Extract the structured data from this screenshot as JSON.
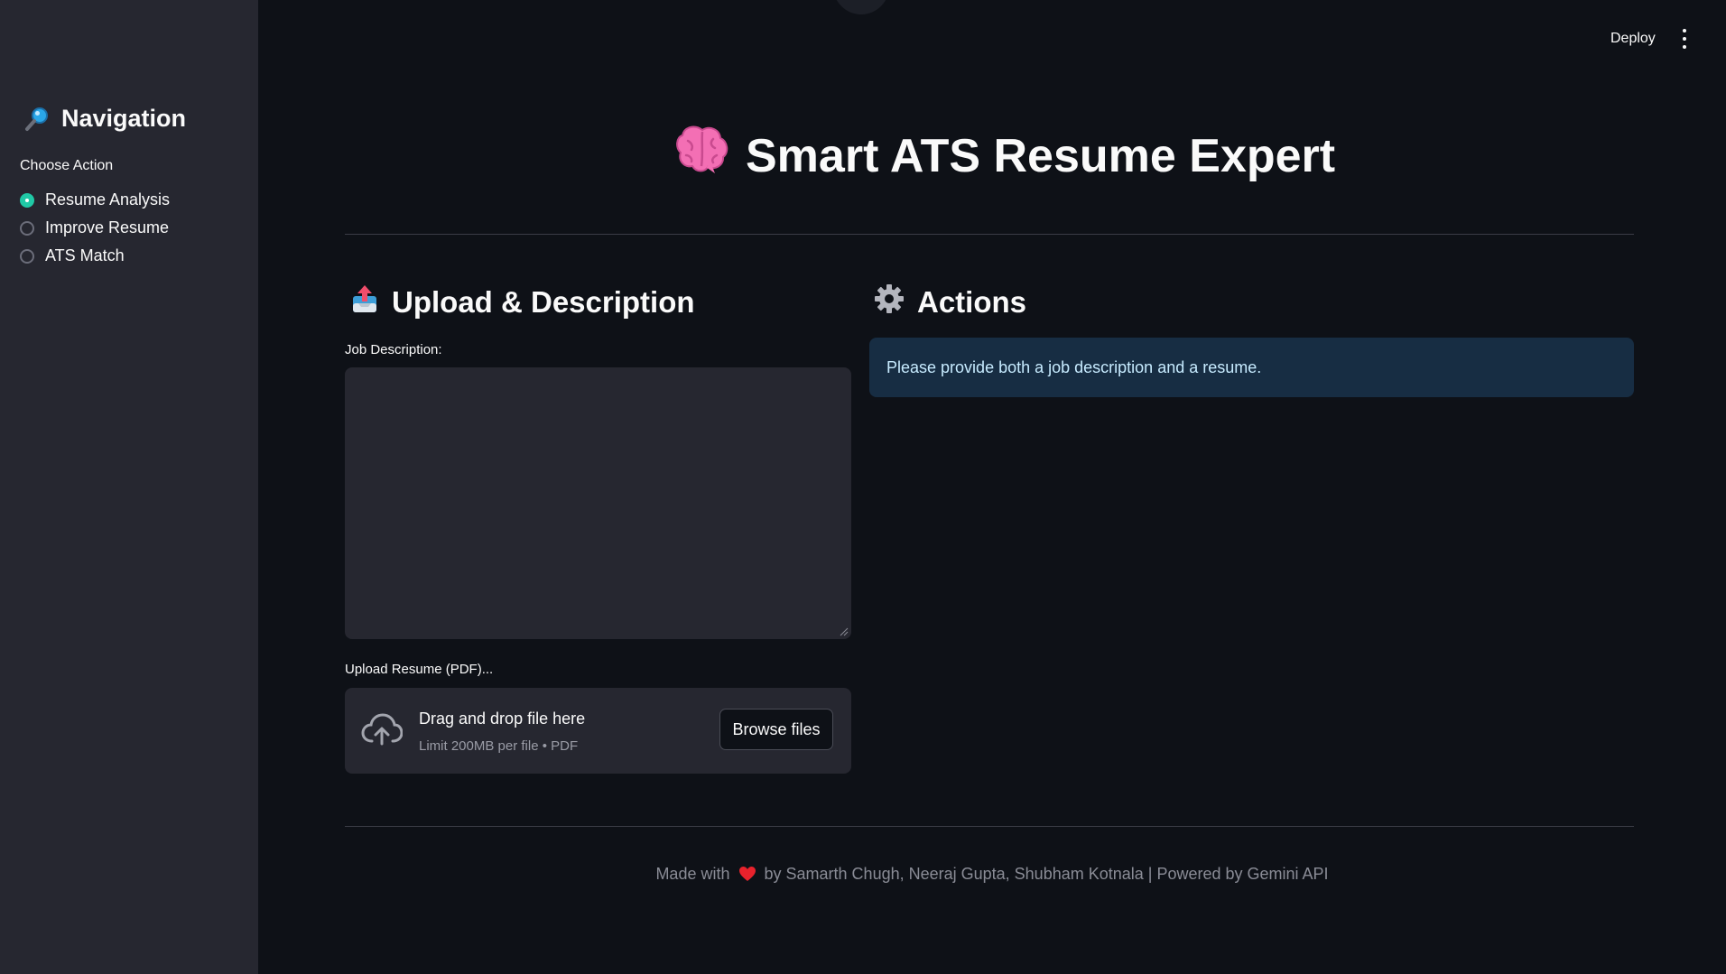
{
  "header": {
    "deploy_label": "Deploy"
  },
  "sidebar": {
    "title": "Navigation",
    "choose_label": "Choose Action",
    "options": [
      {
        "label": "Resume Analysis",
        "selected": true
      },
      {
        "label": "Improve Resume",
        "selected": false
      },
      {
        "label": "ATS Match",
        "selected": false
      }
    ]
  },
  "main": {
    "title": "Smart ATS Resume Expert",
    "upload_section": {
      "heading": "Upload & Description",
      "job_description_label": "Job Description:",
      "job_description_value": "",
      "upload_label": "Upload Resume (PDF)...",
      "dropzone_text": "Drag and drop file here",
      "dropzone_limit": "Limit 200MB per file • PDF",
      "browse_label": "Browse files"
    },
    "actions_section": {
      "heading": "Actions",
      "info_message": "Please provide both a job description and a resume."
    }
  },
  "footer": {
    "made_with": "Made with",
    "credits": "by Samarth Chugh, Neeraj Gupta, Shubham Kotnala | Powered by Gemini API"
  },
  "colors": {
    "background": "#0e1117",
    "sidebar": "#262730",
    "accent_radio": "#20c9a6",
    "info_bg": "#172d43",
    "info_text": "#c7ebff"
  },
  "icons": {
    "nav_title": "magnifying-glass-icon",
    "title": "brain-icon",
    "upload_section": "outbox-tray-icon",
    "actions_section": "gear-icon",
    "dropzone": "cloud-upload-icon",
    "footer": "heart-icon",
    "menu": "vertical-dots-icon"
  }
}
